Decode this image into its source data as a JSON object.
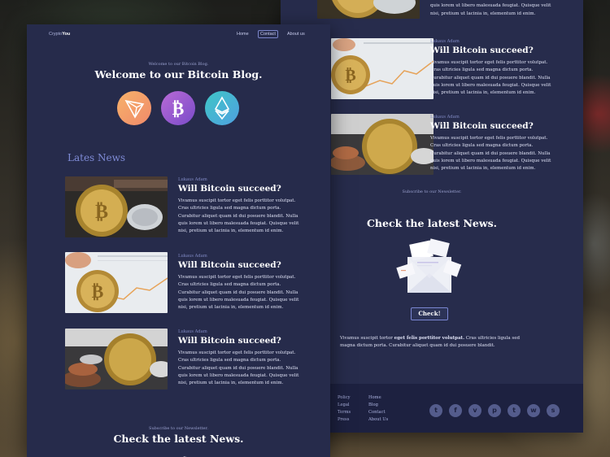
{
  "brand": {
    "prefix": "Crypto",
    "suffix": "You"
  },
  "nav": {
    "home": "Home",
    "contact": "Contact",
    "about": "About us"
  },
  "hero": {
    "eyebrow": "Welcome to our Bitcoin Blog.",
    "title": "Welcome to our Bitcoin Blog."
  },
  "coins": [
    "tron-coin-icon",
    "bitcoin-coin-icon",
    "ethereum-coin-icon"
  ],
  "latest": {
    "heading": "Lates News"
  },
  "posts": [
    {
      "author": "Lukaus Adam",
      "title": "Will Bitcoin succeed?",
      "body": "Vivamus suscipit tortor eget felis porttitor volutpat. Cras ultricies ligula sed magna dictum porta. Curabitur aliquet quam id dui posuere blandit. Nulla quis lorem ut libero malesuada feugiat. Quisque velit nisi, pretium ut lacinia in, elementum id enim."
    },
    {
      "author": "Lukaus Adam",
      "title": "Will Bitcoin succeed?",
      "body": "Vivamus suscipit tortor eget felis porttitor volutpat. Cras ultricies ligula sed magna dictum porta. Curabitur aliquet quam id dui posuere blandit. Nulla quis lorem ut libero malesuada feugiat. Quisque velit nisi, pretium ut lacinia in, elementum id enim."
    },
    {
      "author": "Lukaus Adam",
      "title": "Will Bitcoin succeed?",
      "body": "Vivamus suscipit tortor eget felis porttitor volutpat. Cras ultricies ligula sed magna dictum porta. Curabitur aliquet quam id dui posuere blandit. Nulla quis lorem ut libero malesuada feugiat. Quisque velit nisi, pretium ut lacinia in, elementum id enim."
    }
  ],
  "back_posts": [
    {
      "body_tail": "Curabitur aliquet quam id dui posuere blandit. Nulla quis lorem ut libero malesuada feugiat. Quisque velit nisi, pretium ut lacinia in, elementum id enim."
    },
    {
      "author": "Lukaus Adam",
      "title": "Will Bitcoin succeed?",
      "body": "Vivamus suscipit tortor eget felis porttitor volutpat. Cras ultricies ligula sed magna dictum porta. Curabitur aliquet quam id dui posuere blandit. Nulla quis lorem ut libero malesuada feugiat. Quisque velit nisi, pretium ut lacinia in, elementum id enim."
    },
    {
      "author": "Lukaus Adam",
      "title": "Will Bitcoin succeed?",
      "body": "Vivamus suscipit tortor eget felis porttitor volutpat. Cras ultricies ligula sed magna dictum porta. Curabitur aliquet quam id dui posuere blandit. Nulla quis lorem ut libero malesuada feugiat. Quisque velit nisi, pretium ut lacinia in, elementum id enim."
    }
  ],
  "newsletter": {
    "eyebrow": "Subscribe to our Newsletter.",
    "title": "Check the latest News.",
    "button": "Check!",
    "text_a": "Vivamus suscipit tortor ",
    "text_b": "eget felis porttitor volutpat.",
    "text_c": " Cras ultricies ligula sed magna dictum porta. Curabitur aliquet quam id dui posuere blandit."
  },
  "footer": {
    "col1": [
      "Policy",
      "Legal",
      "Terms",
      "Press"
    ],
    "col2": [
      "Home",
      "Blog",
      "Contact",
      "About Us"
    ],
    "social": [
      "twitter-icon",
      "facebook-icon",
      "vimeo-icon",
      "pinterest-icon",
      "tumblr-icon",
      "whatsapp-icon",
      "snapchat-icon"
    ]
  },
  "colors": {
    "card": "#262b4b",
    "footer": "#1d2140",
    "accent": "#7f8bd6"
  }
}
